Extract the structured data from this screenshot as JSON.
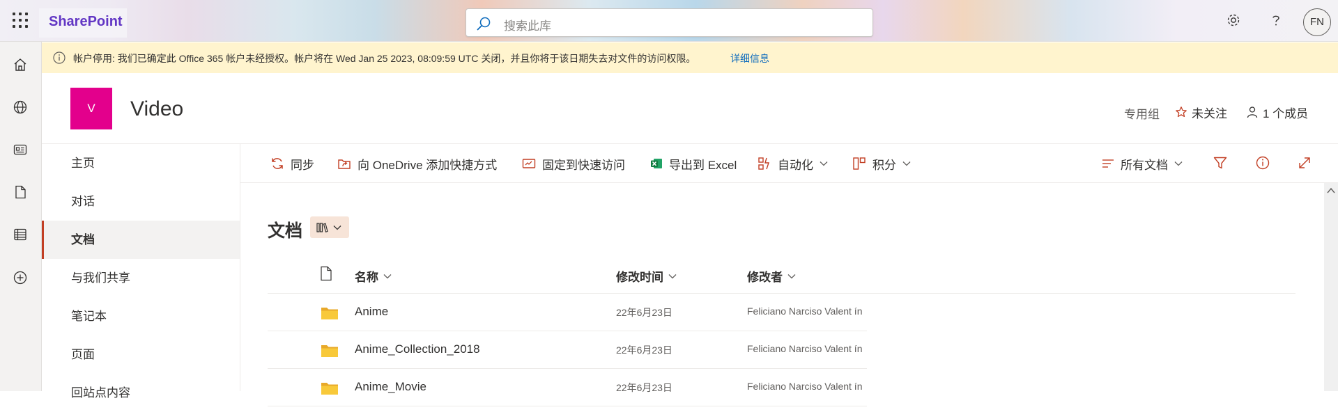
{
  "suite": {
    "app_name": "SharePoint",
    "search_placeholder": "搜索此库",
    "avatar_initials": "FN"
  },
  "notice": {
    "text": "帐户停用: 我们已确定此 Office 365 帐户未经授权。帐户将在 Wed Jan 25 2023, 08:09:59 UTC 关闭，并且你将于该日期失去对文件的访问权限。",
    "link": "详细信息"
  },
  "site": {
    "logo_letter": "V",
    "title": "Video",
    "group_type": "专用组",
    "follow_label": "未关注",
    "members_label": "1 个成员"
  },
  "nav": {
    "items": [
      {
        "label": "主页",
        "selected": false
      },
      {
        "label": "对话",
        "selected": false
      },
      {
        "label": "文档",
        "selected": true
      },
      {
        "label": "与我们共享",
        "selected": false
      },
      {
        "label": "笔记本",
        "selected": false
      },
      {
        "label": "页面",
        "selected": false
      },
      {
        "label": "回站点内容",
        "selected": false
      }
    ]
  },
  "commands": {
    "sync": "同步",
    "onedrive_shortcut": "向 OneDrive 添加快捷方式",
    "pin_quick_access": "固定到快速访问",
    "export_excel": "导出到 Excel",
    "automate": "自动化",
    "integrate": "积分",
    "view_name": "所有文档"
  },
  "library": {
    "heading": "文档",
    "columns": {
      "name": "名称",
      "modified": "修改时间",
      "modified_by": "修改者"
    },
    "rows": [
      {
        "name": "Anime",
        "modified": "22年6月23日",
        "modified_by": "Feliciano Narciso Valent ín"
      },
      {
        "name": "Anime_Collection_2018",
        "modified": "22年6月23日",
        "modified_by": "Feliciano Narciso Valent ín"
      },
      {
        "name": "Anime_Movie",
        "modified": "22年6月23日",
        "modified_by": "Feliciano Narciso Valent ín"
      }
    ]
  },
  "colors": {
    "brand": "#6236c4",
    "logo_bg": "#e3008c",
    "accent_orange": "#c23f24",
    "notice_bg": "#fff4ce",
    "folder": "#f8c93a"
  }
}
